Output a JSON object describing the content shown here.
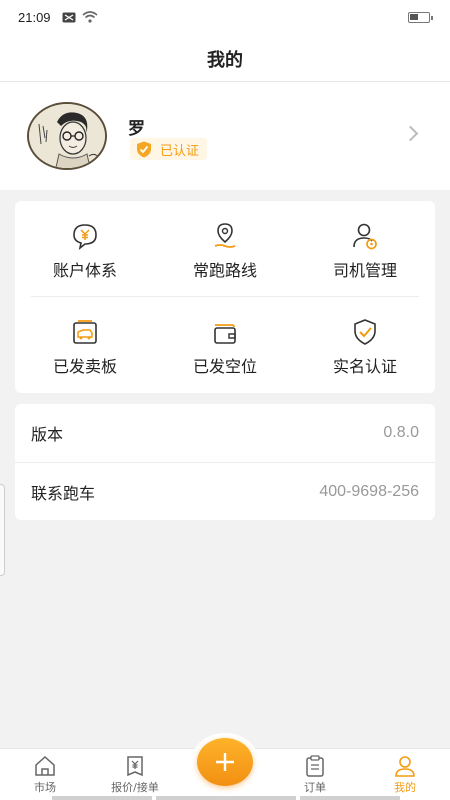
{
  "status": {
    "time": "21:09",
    "battery_level": 0.45
  },
  "nav": {
    "title": "我的"
  },
  "profile": {
    "name": "罗",
    "verify_label": "已认证"
  },
  "grid": [
    {
      "label": "账户体系",
      "icon": "yuan-bubble-icon"
    },
    {
      "label": "常跑路线",
      "icon": "location-pin-icon"
    },
    {
      "label": "司机管理",
      "icon": "driver-icon"
    },
    {
      "label": "已发卖板",
      "icon": "truck-board-icon"
    },
    {
      "label": "已发空位",
      "icon": "wallet-icon"
    },
    {
      "label": "实名认证",
      "icon": "shield-check-icon"
    }
  ],
  "info": [
    {
      "label": "版本",
      "value": "0.8.0"
    },
    {
      "label": "联系跑车",
      "value": "400-9698-256"
    }
  ],
  "tabs": [
    {
      "label": "市场",
      "icon": "home-icon",
      "active": false
    },
    {
      "label": "报价/接单",
      "icon": "quote-icon",
      "active": false
    },
    {
      "label": "订单",
      "icon": "clipboard-icon",
      "active": false
    },
    {
      "label": "我的",
      "icon": "user-icon",
      "active": true
    }
  ],
  "colors": {
    "accent": "#f39c12",
    "background": "#f2f2f2",
    "text": "#222222",
    "muted": "#999999"
  }
}
